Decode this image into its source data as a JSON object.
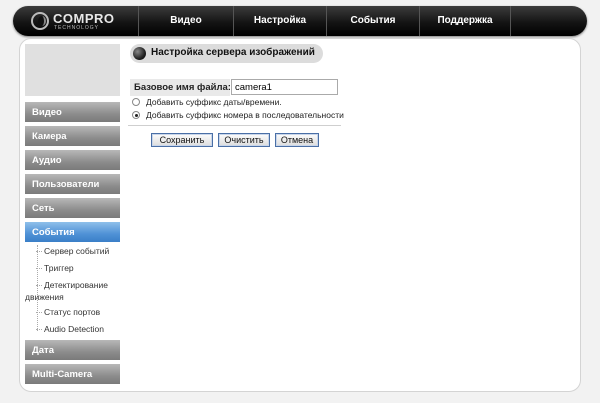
{
  "header": {
    "logo_name": "COMPRO",
    "logo_sub": "TECHNOLOGY",
    "nav": [
      "Видео",
      "Настройка",
      "События",
      "Поддержка"
    ]
  },
  "sidebar": {
    "items": [
      "Видео",
      "Камера",
      "Аудио",
      "Пользователи",
      "Сеть",
      "События",
      "Дата",
      "Multi-Camera"
    ],
    "active": "События",
    "subitems": [
      "Сервер событий",
      "Триггер",
      "Детектирование",
      "движения",
      "Статус портов",
      "Audio Detection"
    ]
  },
  "panel": {
    "title": "Настройка сервера изображений",
    "base_name_label": "Базовое имя файла:",
    "base_name_value": "camera1",
    "radio_options": [
      {
        "label": "Добавить суффикс даты/времени.",
        "checked": false
      },
      {
        "label": "Добавить суффикс номера в последовательности",
        "checked": true
      }
    ],
    "buttons": {
      "save": "Сохранить",
      "clear": "Очистить",
      "cancel": "Отмена"
    }
  },
  "colors": {
    "topbar": "#141414",
    "menu_item": "#8c8c8c",
    "menu_active": "#4f91d6",
    "button_border": "#4a6fa6"
  }
}
